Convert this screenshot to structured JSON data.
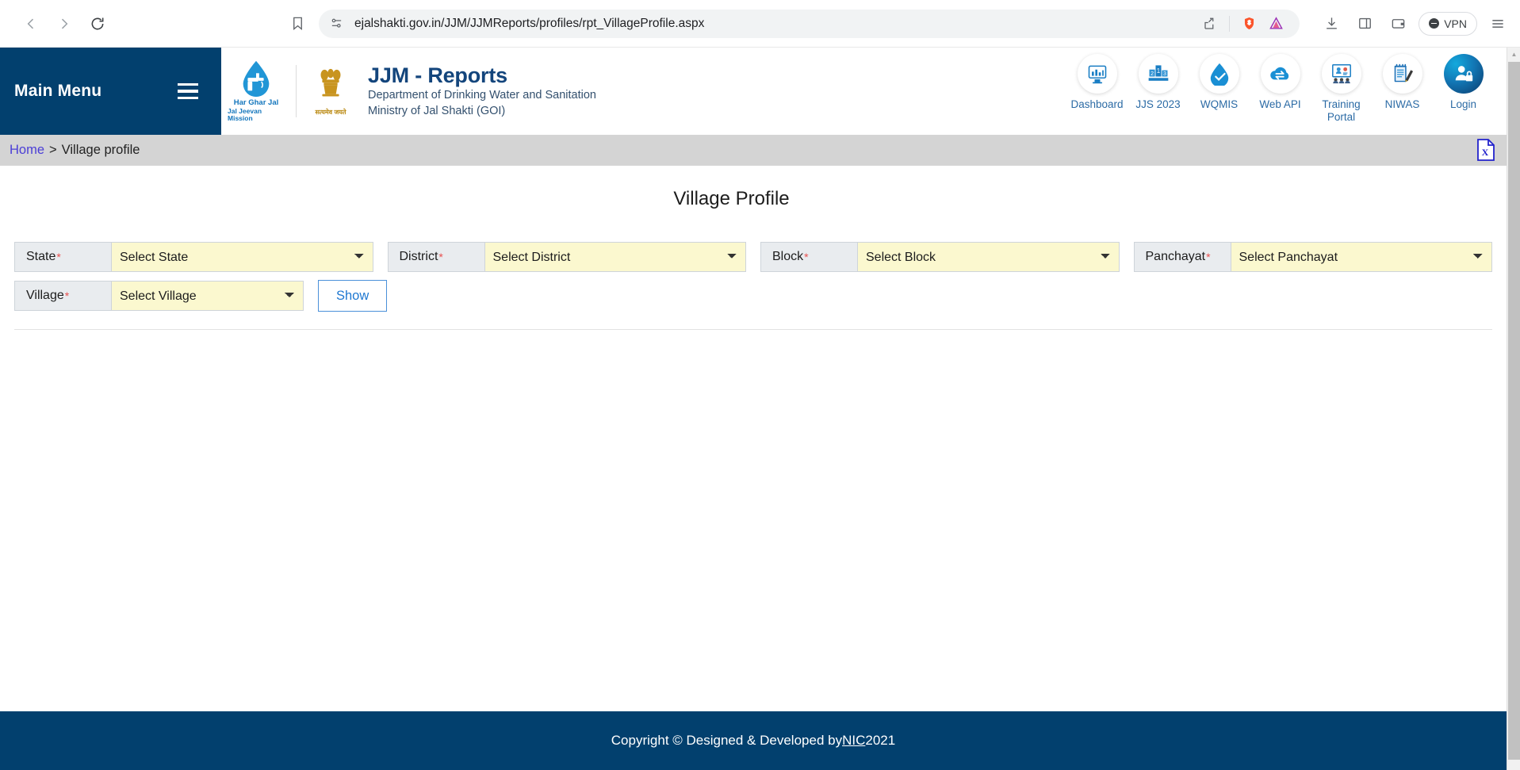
{
  "browser": {
    "back_icon": "chevron-left-icon",
    "forward_icon": "chevron-right-icon",
    "reload_icon": "reload-icon",
    "bookmark_icon": "bookmark-icon",
    "url": "ejalshakti.gov.in/JJM/JJMReports/profiles/rpt_VillageProfile.aspx",
    "site_info_icon": "site-settings-icon",
    "share_icon": "share-icon",
    "brave_icon": "brave-shields-icon",
    "bat_icon": "brave-rewards-icon",
    "download_icon": "download-icon",
    "sidebar_icon": "sidebar-panel-icon",
    "wallet_icon": "wallet-icon",
    "vpn_label": "VPN",
    "menu_icon": "hamburger-menu-icon"
  },
  "sidebar": {
    "title": "Main Menu",
    "toggle_icon": "hamburger-menu-icon"
  },
  "brand": {
    "logo_left_icon": "har-ghar-jal-droplet-tap-logo",
    "logo_left_caption1": "Har Ghar Jal",
    "logo_left_caption2": "Jal Jeevan Mission",
    "emblem_icon": "ashoka-lion-capital-emblem",
    "emblem_caption": "सत्यमेव जयते",
    "title": "JJM - Reports",
    "subtitle_line1": "Department of Drinking Water and Sanitation",
    "subtitle_line2": "Ministry of Jal Shakti (GOI)"
  },
  "topnav": [
    {
      "label": "Dashboard",
      "icon": "dashboard-monitor-chart-icon"
    },
    {
      "label": "JJS 2023",
      "icon": "podium-ranking-icon"
    },
    {
      "label": "WQMIS",
      "icon": "water-droplet-check-icon"
    },
    {
      "label": "Web API",
      "icon": "cloud-exchange-arrows-icon"
    },
    {
      "label": "Training Portal",
      "icon": "training-presentation-icon"
    },
    {
      "label": "NIWAS",
      "icon": "notepad-pencil-icon"
    },
    {
      "label": "Login",
      "icon": "user-lock-login-icon"
    }
  ],
  "breadcrumb": {
    "home": "Home",
    "separator": ">",
    "current": "Village profile",
    "export_icon": "excel-export-icon"
  },
  "main": {
    "title": "Village Profile",
    "fields": [
      {
        "label": "State",
        "required": "*",
        "value": "Select State",
        "name": "state-select"
      },
      {
        "label": "District",
        "required": "*",
        "value": "Select District",
        "name": "district-select"
      },
      {
        "label": "Block",
        "required": "*",
        "value": "Select Block",
        "name": "block-select"
      },
      {
        "label": "Panchayat",
        "required": "*",
        "value": "Select Panchayat",
        "name": "panchayat-select"
      },
      {
        "label": "Village",
        "required": "*",
        "value": "Select Village",
        "name": "village-select"
      }
    ],
    "show_button": "Show"
  },
  "footer": {
    "text_before": "Copyright © Designed & Developed by ",
    "link": "NIC",
    "text_after": " 2021"
  },
  "colors": {
    "header_blue": "#02406E",
    "accent_blue": "#2c6ba5",
    "field_yellow": "#fbf8cf",
    "label_gray": "#e9ecef",
    "crumb_gray": "#d4d4d4",
    "required_red": "#e8504f",
    "link_purple": "#4b3ed6"
  }
}
